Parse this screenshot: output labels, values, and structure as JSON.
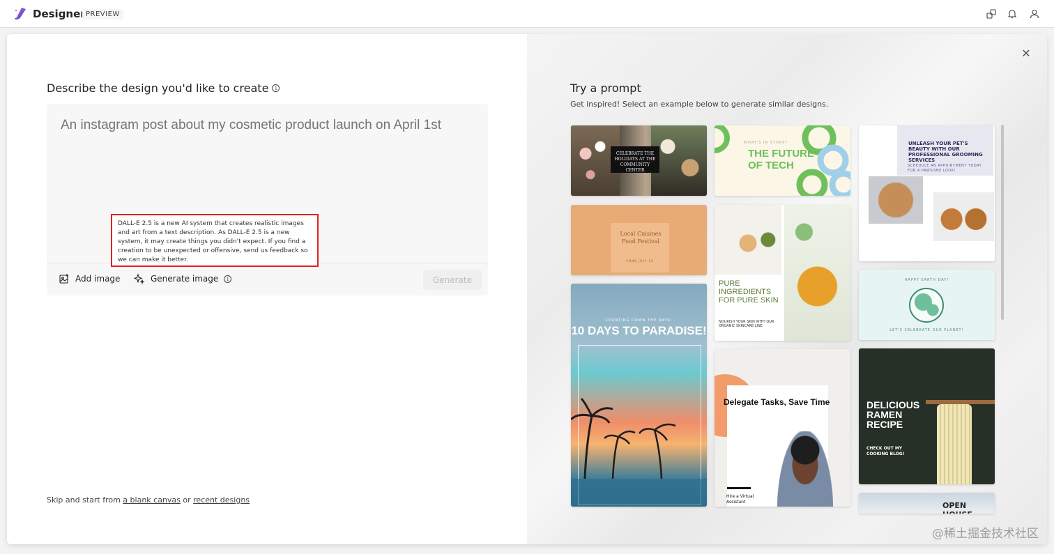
{
  "app": {
    "title": "Designer",
    "badge": "PREVIEW"
  },
  "topbar_icons": [
    "share-icon",
    "notification-icon",
    "account-icon"
  ],
  "describe": {
    "title": "Describe the design you'd like to create",
    "placeholder": "An instagram post about my cosmetic product launch on April 1st",
    "add_image": "Add image",
    "generate_image": "Generate image",
    "generate_button": "Generate",
    "tooltip": "DALL-E 2.5 is a new AI system that creates realistic images and art from a text description. As DALL-E 2.5 is a new system, it may create things you didn't expect. If you find a creation to be unexpected or offensive, send us feedback so we can make it better."
  },
  "skip": {
    "prefix": "Skip and start from ",
    "blank_canvas": "a blank canvas",
    "middle": " or ",
    "recent_designs": "recent designs"
  },
  "try_prompt": {
    "title": "Try a prompt",
    "subtitle": "Get inspired! Select an example below to generate similar designs."
  },
  "cards": {
    "holidays": "CELEBRATE THE HOLIDAYS AT THE COMMUNITY CENTER",
    "tech_small": "WHAT'S IN STORE?",
    "tech_big": "THE FUTURE OF TECH",
    "pets_title": "UNLEASH YOUR PET'S BEAUTY WITH OUR PROFESSIONAL GROOMING SERVICES",
    "pets_sub": "SCHEDULE AN APPOINTMENT TODAY FOR A PAWSOME LOOK!",
    "cuisines": "Local Cuisines Food Festival",
    "cuisines_date": "CONE JULY 15",
    "ingredients_title": "PURE INGREDIENTS FOR PURE SKIN",
    "ingredients_sub": "NOURISH YOUR SKIN WITH OUR ORGANIC SKINCARE LINE",
    "paradise_small": "COUNTING DOWN THE DAYS!",
    "paradise_big": "10 DAYS TO PARADISE!",
    "earth_small": "HAPPY EARTH DAY!",
    "earth_foot": "LET'S CELEBRATE OUR PLANET!",
    "delegate_title": "Delegate Tasks, Save Time",
    "delegate_sub": "Hire a Virtual Assistant",
    "ramen_title": "DELICIOUS RAMEN RECIPE",
    "ramen_sub": "CHECK OUT MY COOKING BLOG!",
    "open_house": "OPEN HOUSE"
  },
  "watermark": "@稀土掘金技术社区",
  "colors": {
    "highlight_border": "#e02020",
    "accent": "#8a5cf6"
  }
}
